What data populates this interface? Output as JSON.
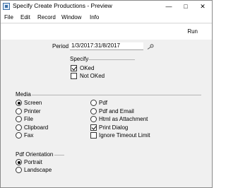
{
  "window": {
    "title": "Specify Create Productions - Preview"
  },
  "menubar": {
    "items": [
      "File",
      "Edit",
      "Record",
      "Window",
      "Info"
    ]
  },
  "toolbar": {
    "run_label": "Run"
  },
  "form": {
    "period_label": "Period",
    "period_value": "1/3/2017:31/8/2017",
    "specify_label": "Specify",
    "oked_label": "OKed",
    "oked_checked": true,
    "not_oked_label": "Not OKed",
    "not_oked_checked": false
  },
  "media": {
    "label": "Media",
    "options_left": [
      "Screen",
      "Printer",
      "File",
      "Clipboard",
      "Fax"
    ],
    "options_right": [
      "Pdf",
      "Pdf and Email",
      "Html as Attachment"
    ],
    "selected": "Screen",
    "print_dialog_label": "Print Dialog",
    "print_dialog_checked": true,
    "ignore_timeout_label": "Ignore Timeout Limit",
    "ignore_timeout_checked": false
  },
  "pdf_orientation": {
    "label": "Pdf Orientation",
    "options": [
      "Portrait",
      "Landscape"
    ],
    "selected": "Portrait"
  },
  "icons": {
    "app": "app-icon",
    "period_paste": "key-icon"
  }
}
